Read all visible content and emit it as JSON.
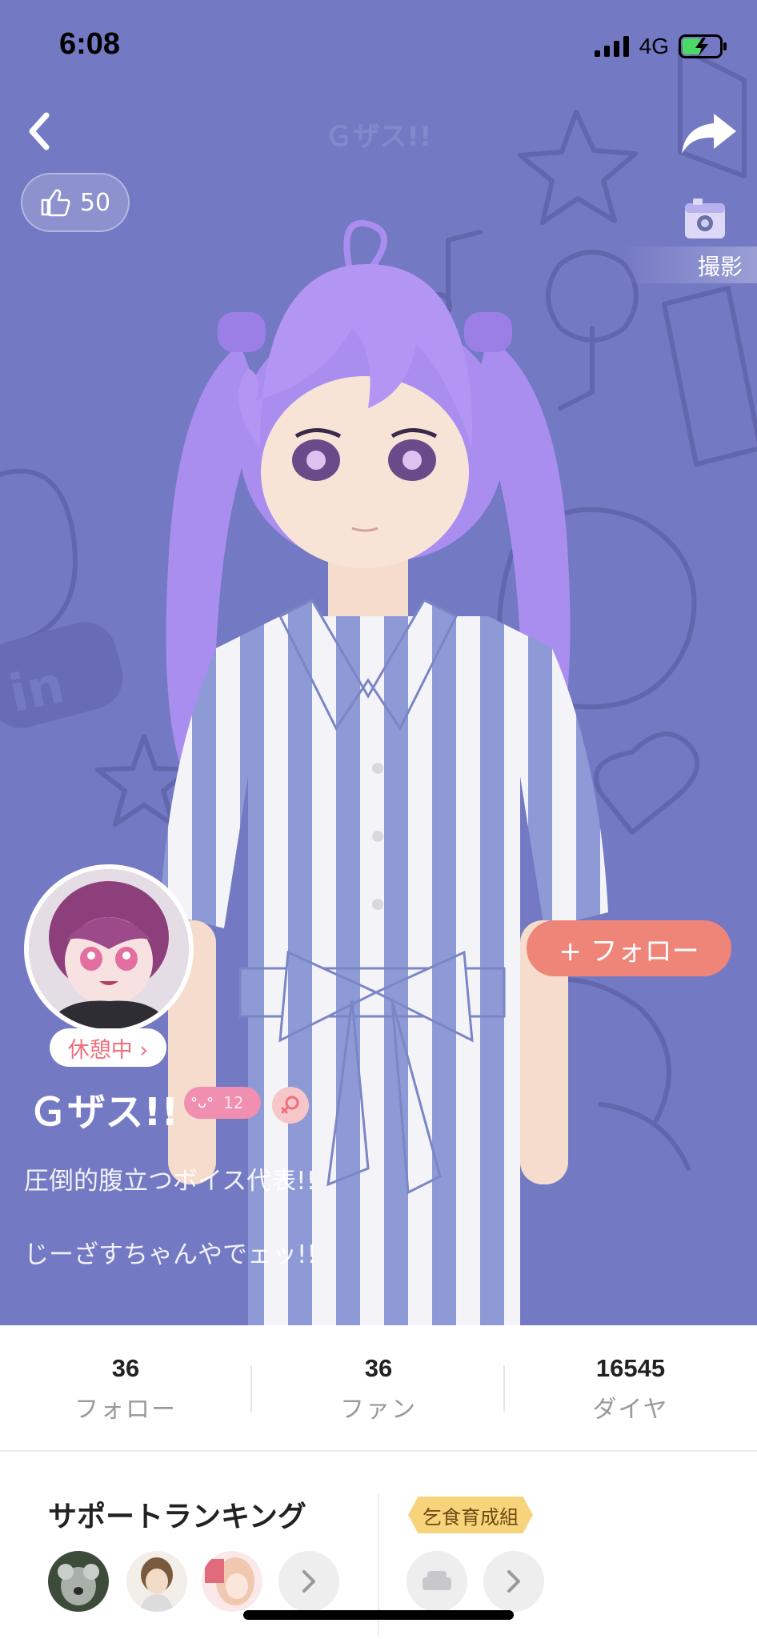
{
  "status_bar": {
    "time": "6:08",
    "network": "4G"
  },
  "nav": {
    "title": "Ｇザス!!"
  },
  "likes": {
    "count": "50"
  },
  "photo": {
    "label": "撮影"
  },
  "profile": {
    "status_label": "休憩中 ›",
    "username": "Ｇザス!!",
    "level": "12",
    "bio_lines": [
      "圧倒的腹立つボイス代表!!",
      "じーざすちゃんやでェッ!!"
    ],
    "follow_label": "+ フォロー"
  },
  "stats": [
    {
      "value": "36",
      "label": "フォロー"
    },
    {
      "value": "36",
      "label": "ファン"
    },
    {
      "value": "16545",
      "label": "ダイヤ"
    }
  ],
  "support": {
    "title": "サポートランキング",
    "group_label": "乞食育成組"
  },
  "colors": {
    "hero_bg": "#7479c4",
    "follow": "#ef8478",
    "rest_text": "#ee6f7c",
    "hair": "#a98ef0"
  }
}
